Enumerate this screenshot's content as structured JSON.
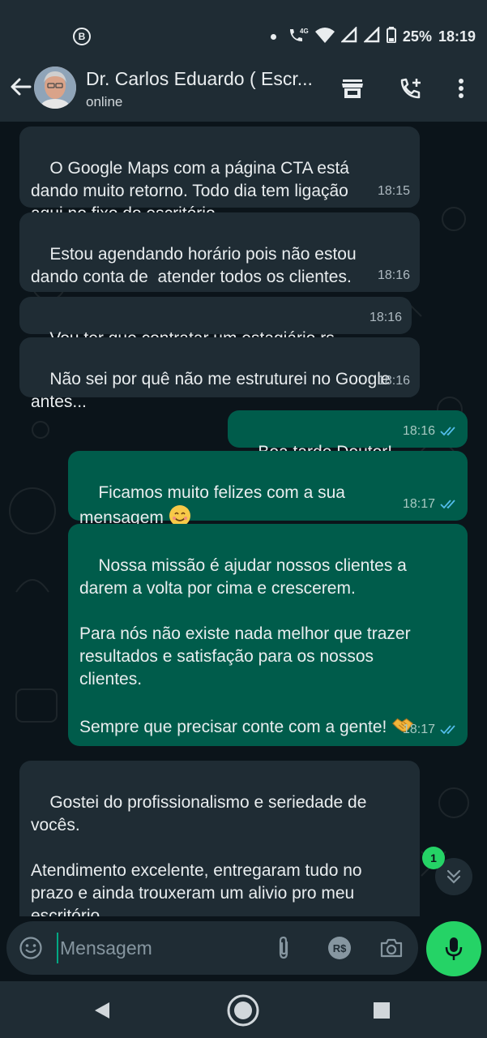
{
  "status_bar": {
    "left_icon_letter": "B",
    "network": "4G",
    "battery": "25%",
    "time": "18:19"
  },
  "header": {
    "contact_name": "Dr. Carlos Eduardo ( Escr...",
    "contact_status": "online",
    "icons": [
      "back-arrow-icon",
      "store-icon",
      "add-call-icon",
      "more-vert-icon"
    ]
  },
  "messages": [
    {
      "dir": "in",
      "text": "O Google Maps com a página CTA está\ndando muito retorno. Todo dia tem ligação\naqui no fixo do escritório.",
      "time": "18:15"
    },
    {
      "dir": "in",
      "text": "Estou agendando horário pois não estou\ndando conta de  atender todos os clientes.",
      "time": "18:16"
    },
    {
      "dir": "in",
      "text": "Vou ter que contratar um estagiário rs",
      "time": "18:16"
    },
    {
      "dir": "in",
      "text": "Não sei por quê não me estruturei no Google\nantes...",
      "time": "18:16"
    },
    {
      "dir": "out",
      "text": "Boa tarde Doutor!",
      "time": "18:16",
      "status": "read"
    },
    {
      "dir": "out",
      "text": "Ficamos muito felizes com a sua\nmensagem ",
      "emoji": "smiling-face-emoji",
      "time": "18:17",
      "status": "read"
    },
    {
      "dir": "out",
      "text": "Nossa missão é ajudar nossos clientes a\ndarem a volta por cima e crescerem.\n\nPara nós não existe nada melhor que trazer\nresultados e satisfação para os nossos\nclientes.\n\nSempre que precisar conte com a gente! ",
      "emoji": "handshake-emoji",
      "time": "18:17",
      "status": "read"
    },
    {
      "dir": "in",
      "text": "Gostei do profissionalismo e seriedade de\nvocês.\n\nAtendimento excelente, entregaram tudo no\nprazo e ainda trouxeram um alivio pro meu\nescritório."
    }
  ],
  "unread_count": "1",
  "input": {
    "placeholder": "Mensagem",
    "currency_label": "R$"
  },
  "colors": {
    "background": "#0b141a",
    "incoming_bubble": "#1f2c34",
    "outgoing_bubble": "#005c4b",
    "accent": "#25d366",
    "read_tick": "#53bdeb"
  }
}
